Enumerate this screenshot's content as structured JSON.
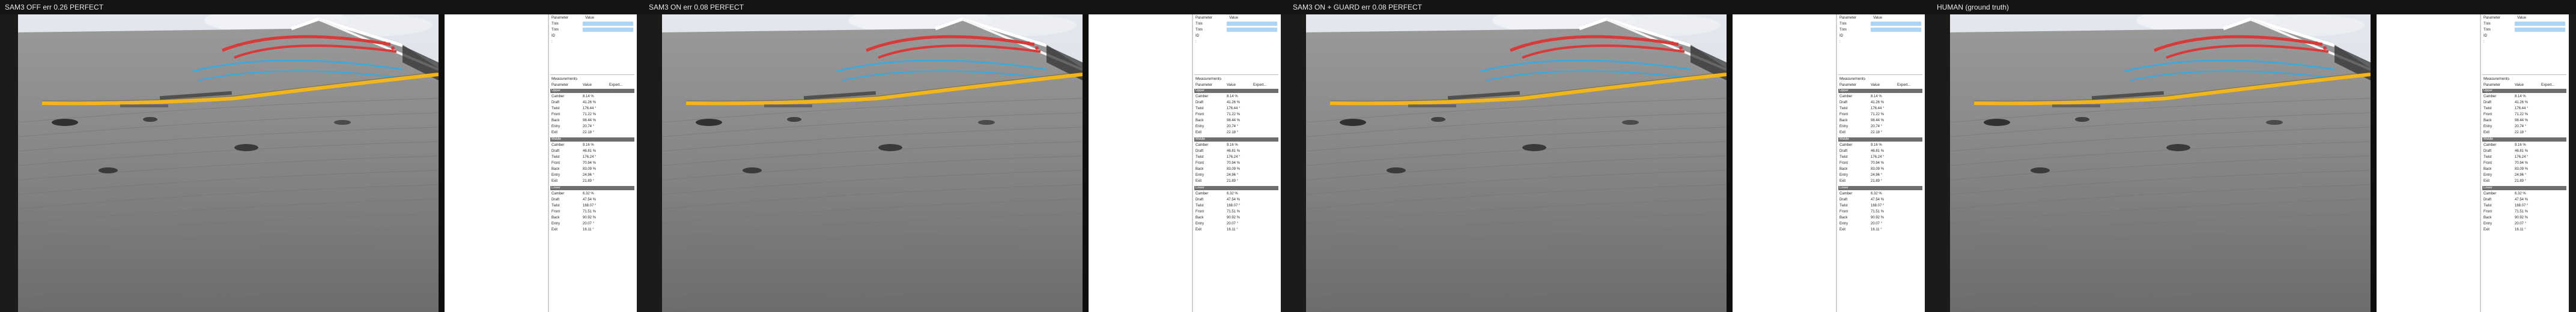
{
  "panels": [
    {
      "title": "SAM3 OFF  err 0.26  PERFECT"
    },
    {
      "title": "SAM3 ON  err 0.08  PERFECT"
    },
    {
      "title": "SAM3 ON + GUARD  err 0.08  PERFECT"
    },
    {
      "title": "HUMAN (ground truth)"
    }
  ],
  "params_panel": {
    "header_param": "Parameter",
    "header_value": "Value",
    "row1": "Trim",
    "row2": "Trim",
    "row3": "ID",
    "colon": ":"
  },
  "measurements": {
    "title": "Measurements",
    "col_param": "Parameter",
    "col_value": "Value",
    "col_expert": "Expert...",
    "sections": [
      {
        "name": "Upper",
        "rows": [
          {
            "label": "Camber",
            "value": "8.14 %"
          },
          {
            "label": "Draft",
            "value": "41.26 %"
          },
          {
            "label": "Twist",
            "value": "176.44 °"
          },
          {
            "label": "Front",
            "value": "71.22 %"
          },
          {
            "label": "Back",
            "value": "98.44 %"
          },
          {
            "label": "Entry",
            "value": "20.74 °"
          },
          {
            "label": "Exit",
            "value": "22.18 °"
          }
        ]
      },
      {
        "name": "Middle",
        "rows": [
          {
            "label": "Camber",
            "value": "9.16 %"
          },
          {
            "label": "Draft",
            "value": "46.81 %"
          },
          {
            "label": "Twist",
            "value": "176.24 °"
          },
          {
            "label": "Front",
            "value": "70.94 %"
          },
          {
            "label": "Back",
            "value": "83.09 %"
          },
          {
            "label": "Entry",
            "value": "24.96 °"
          },
          {
            "label": "Exit",
            "value": "21.89 °"
          }
        ]
      },
      {
        "name": "Lower",
        "rows": [
          {
            "label": "Camber",
            "value": "6.32 %"
          },
          {
            "label": "Draft",
            "value": "47.54 %"
          },
          {
            "label": "Twist",
            "value": "168.07 °"
          },
          {
            "label": "Front",
            "value": "71.51 %"
          },
          {
            "label": "Back",
            "value": "90.92 %"
          },
          {
            "label": "Entry",
            "value": "20.07 °"
          },
          {
            "label": "Exit",
            "value": "16.11 °"
          }
        ]
      }
    ]
  },
  "colors": {
    "upper_stripe": "#d83a3a",
    "middle_stripe": "#3fa8d8",
    "lower_stripe": "#f2b61c",
    "selected_value": "#aed4f3"
  }
}
